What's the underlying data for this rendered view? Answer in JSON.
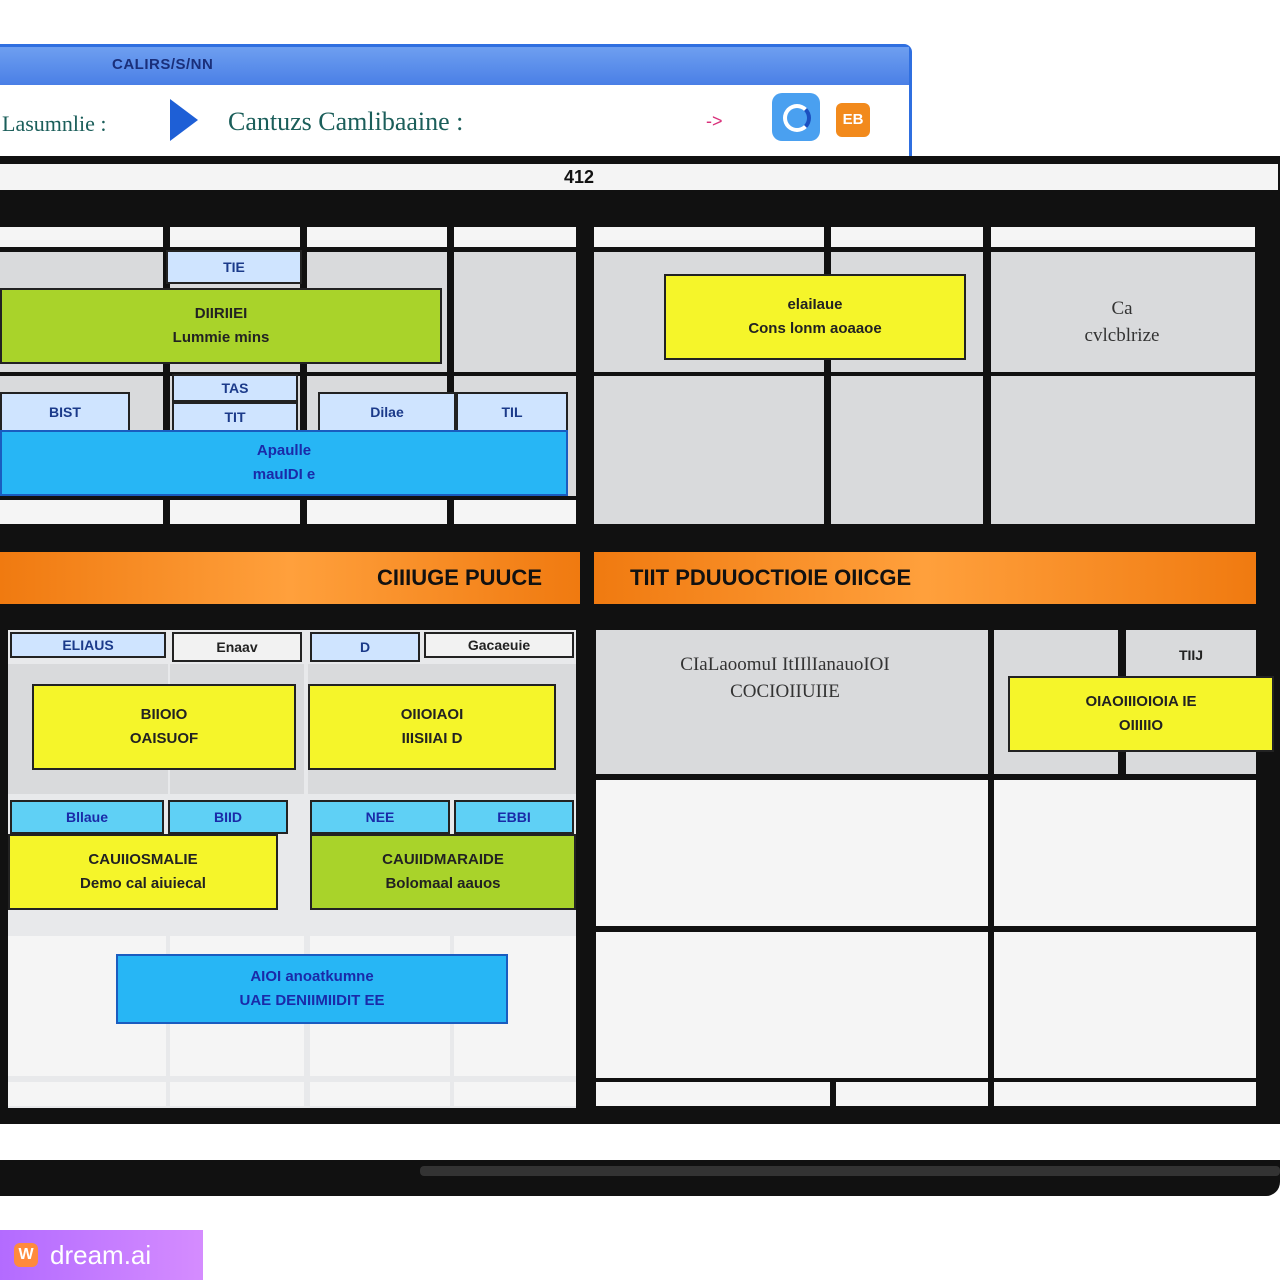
{
  "browser": {
    "title": "CALIRS/S/NN",
    "breadcrumb": [
      "Lasumnlie :",
      "Cantuzs Camlibaaine :"
    ],
    "nav_arrow": "->",
    "ext_icon_text": "EB"
  },
  "tablet": {
    "top_label": "412"
  },
  "top_left": {
    "tag_1": "TIE",
    "green_card": [
      "DIIRIIEI",
      "Lummie mins"
    ],
    "tag_2": "TAS",
    "tag_3": "BIST",
    "tag_4": "TIT",
    "tag_5": "Dilae",
    "tag_6": "TIL",
    "cyan_card": [
      "Apaulle",
      "mauIDI e"
    ]
  },
  "top_right": {
    "yellow_card": [
      "elaiIaue",
      "Cons lonm aoaaoe"
    ],
    "note": [
      "Ca",
      "cvlcblrize"
    ]
  },
  "bands": {
    "left": "CIIIUGE PUUCE",
    "right": "TIIT PDUUOCTIOIE OIICGE"
  },
  "bottom_left": {
    "header_tabs": [
      "ELIAUS",
      "Enaav",
      "D",
      "Gacaeuie"
    ],
    "card_1": [
      "BIIOIO",
      "OAISUOF"
    ],
    "card_2": [
      "OIIOIAOI",
      "IIISIIAI D"
    ],
    "tags_row": [
      "Bllaue",
      "BIID",
      "NEE",
      "EBBI"
    ],
    "card_3": [
      "CAUIIOSMALIE",
      "Demo cal aiuiecal"
    ],
    "card_4": [
      "CAUIIDMARAIDE",
      "Bolomaal aauos"
    ],
    "cyan_card": [
      "AIOI anoatkumne",
      "UAE DENIIMIIDIT EE"
    ]
  },
  "bottom_right": {
    "note": [
      "CIaLaoomuI ItIIlIanauoIOI",
      "COCIOIIUIIE"
    ],
    "tag": "TIIJ",
    "yellow_card": [
      "OIAOIIIOIOIA IE",
      "OIIIIIO"
    ]
  },
  "watermark": {
    "logo": "W",
    "text": "dream.ai"
  },
  "colors": {
    "accent_blue": "#2f6fe0",
    "green": "#a9d32a",
    "yellow": "#f5f52a",
    "cyan": "#27b6f5",
    "orange": "#f07a10"
  }
}
